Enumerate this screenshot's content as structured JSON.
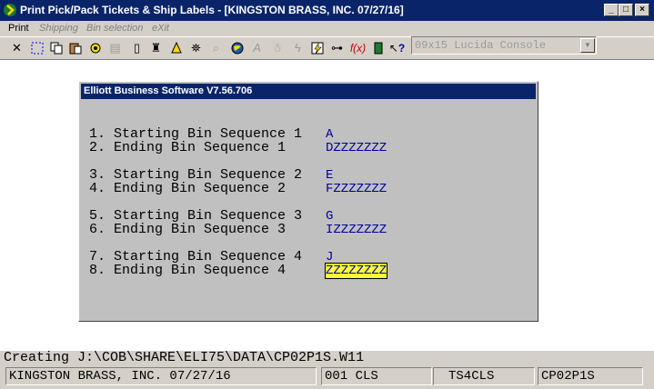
{
  "window": {
    "title": "Print Pick/Pack Tickets & Ship Labels - [KINGSTON BRASS, INC. 07/27/16]",
    "minimize_label": "_",
    "maximize_label": "□",
    "close_label": "×"
  },
  "menu": {
    "items": [
      {
        "label": "Print",
        "enabled": true
      },
      {
        "label": "Shipping",
        "enabled": false
      },
      {
        "label": "Bin selection",
        "enabled": false
      },
      {
        "label": "eXit",
        "enabled": false
      }
    ]
  },
  "toolbar": {
    "icons": [
      "close-icon",
      "select-icon",
      "copy-icon",
      "paste-icon",
      "settings-icon",
      "properties-icon",
      "document-icon",
      "print-setup-icon",
      "bell-icon",
      "binoculars-icon",
      "magnifier-icon",
      "globe-icon",
      "font-icon",
      "help-person-icon",
      "lightning-icon",
      "run-icon",
      "link-icon",
      "function-icon",
      "book-icon",
      "whats-this-icon"
    ],
    "font_select": "09x15 Lucida Console"
  },
  "dialog": {
    "title": "Elliott Business Software V7.56.706",
    "rows": [
      {
        "label": "1. Starting Bin Sequence 1",
        "value": "A"
      },
      {
        "label": "2. Ending Bin Sequence 1",
        "value": "DZZZZZZZ"
      },
      {
        "label": "3. Starting Bin Sequence 2",
        "value": "E"
      },
      {
        "label": "4. Ending Bin Sequence 2",
        "value": "FZZZZZZZ"
      },
      {
        "label": "5. Starting Bin Sequence 3",
        "value": "G"
      },
      {
        "label": "6. Ending Bin Sequence 3",
        "value": "IZZZZZZZ"
      },
      {
        "label": "7. Starting Bin Sequence 4",
        "value": "J"
      },
      {
        "label": "8. Ending Bin Sequence 4",
        "value": "ZZZZZZZZ"
      }
    ]
  },
  "status_line": "Creating J:\\COB\\SHARE\\ELI75\\DATA\\CP02P1S.W11",
  "statusbar": {
    "company": "KINGSTON BRASS, INC. 07/27/16",
    "user": "001 CLS",
    "terminal": "TS4CLS",
    "program": "CP02P1S"
  }
}
